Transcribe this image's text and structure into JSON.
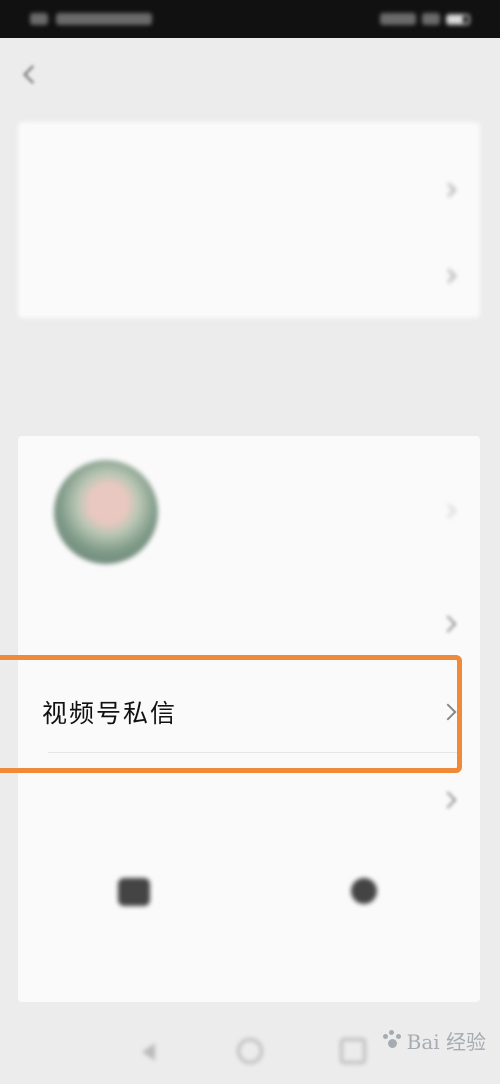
{
  "status_bar": {
    "left_text": "",
    "right_text": ""
  },
  "header": {
    "back_icon": "chevron-left-icon"
  },
  "top_card": {
    "rows": [
      {
        "label": "",
        "icon": "chevron-right-icon"
      },
      {
        "label": "",
        "icon": "chevron-right-icon"
      }
    ]
  },
  "section_label": "",
  "profile": {
    "name": "",
    "subtitle": ""
  },
  "menu": {
    "rows": [
      {
        "label": "",
        "icon": "chevron-right-icon"
      },
      {
        "label": "视频号私信",
        "icon": "chevron-right-icon"
      },
      {
        "label": "",
        "icon": "chevron-right-icon"
      }
    ]
  },
  "actions": [
    {
      "label": "",
      "icon": "camera-icon"
    },
    {
      "label": "",
      "icon": "live-icon"
    }
  ],
  "nav_bar": {
    "buttons": [
      "back-triangle-icon",
      "home-circle-icon",
      "recent-square-icon"
    ]
  },
  "watermark": {
    "text": "Bai  经验"
  },
  "colors": {
    "background": "#ececec",
    "card": "#fafafa",
    "highlight": "#ee8a3a",
    "status_bar": "#111111"
  }
}
